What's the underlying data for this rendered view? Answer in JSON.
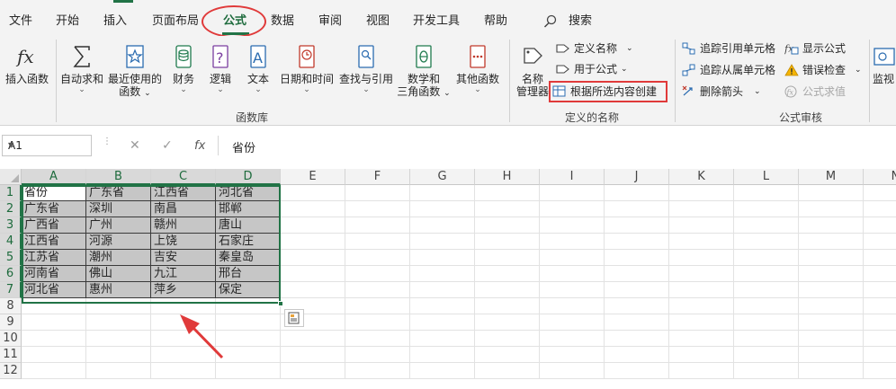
{
  "menu": {
    "tabs": [
      {
        "label": "文件",
        "active": false
      },
      {
        "label": "开始",
        "active": false
      },
      {
        "label": "插入",
        "active": false
      },
      {
        "label": "页面布局",
        "active": false
      },
      {
        "label": "公式",
        "active": true
      },
      {
        "label": "数据",
        "active": false
      },
      {
        "label": "审阅",
        "active": false
      },
      {
        "label": "视图",
        "active": false
      },
      {
        "label": "开发工具",
        "active": false
      },
      {
        "label": "帮助",
        "active": false
      }
    ],
    "search_label": "搜索"
  },
  "ribbon": {
    "function_library": {
      "group_label": "函数库",
      "insert_function": "插入函数",
      "autosum": "自动求和",
      "recent": [
        "最近使用的",
        "函数"
      ],
      "financial": "财务",
      "logical": "逻辑",
      "text": "文本",
      "datetime": "日期和时间",
      "lookup": "查找与引用",
      "math": [
        "数学和",
        "三角函数"
      ],
      "more": "其他函数"
    },
    "defined_names": {
      "group_label": "定义的名称",
      "name_manager": [
        "名称",
        "管理器"
      ],
      "define_name": "定义名称",
      "use_in_formula": "用于公式",
      "create_from_selection": "根据所选内容创建"
    },
    "formula_auditing": {
      "group_label": "公式审核",
      "trace_precedents": "追踪引用单元格",
      "trace_dependents": "追踪从属单元格",
      "remove_arrows": "删除箭头",
      "show_formulas": "显示公式",
      "error_checking": "错误检查",
      "evaluate_formula": "公式求值",
      "watch_window": "监视"
    }
  },
  "formula_bar": {
    "name_box": "A1",
    "cancel_glyph": "✕",
    "enter_glyph": "✓",
    "fx_label": "fx",
    "value": "省份"
  },
  "sheet": {
    "columns": [
      "A",
      "B",
      "C",
      "D",
      "E",
      "F",
      "G",
      "H",
      "I",
      "J",
      "K",
      "L",
      "M",
      "N"
    ],
    "rows": [
      "1",
      "2",
      "3",
      "4",
      "5",
      "6",
      "7",
      "8",
      "9",
      "10",
      "11",
      "12"
    ],
    "data": [
      [
        "省份",
        "广东省",
        "江西省",
        "河北省"
      ],
      [
        "广东省",
        "深圳",
        "南昌",
        "邯郸"
      ],
      [
        "广西省",
        "广州",
        "赣州",
        "唐山"
      ],
      [
        "江西省",
        "河源",
        "上饶",
        "石家庄"
      ],
      [
        "江苏省",
        "潮州",
        "吉安",
        "秦皇岛"
      ],
      [
        "河南省",
        "佛山",
        "九江",
        "邢台"
      ],
      [
        "河北省",
        "惠州",
        "萍乡",
        "保定"
      ]
    ]
  },
  "colors": {
    "accent_green": "#217346",
    "annotation_red": "#e03a3a",
    "selection_fill": "#c6c6c6"
  }
}
